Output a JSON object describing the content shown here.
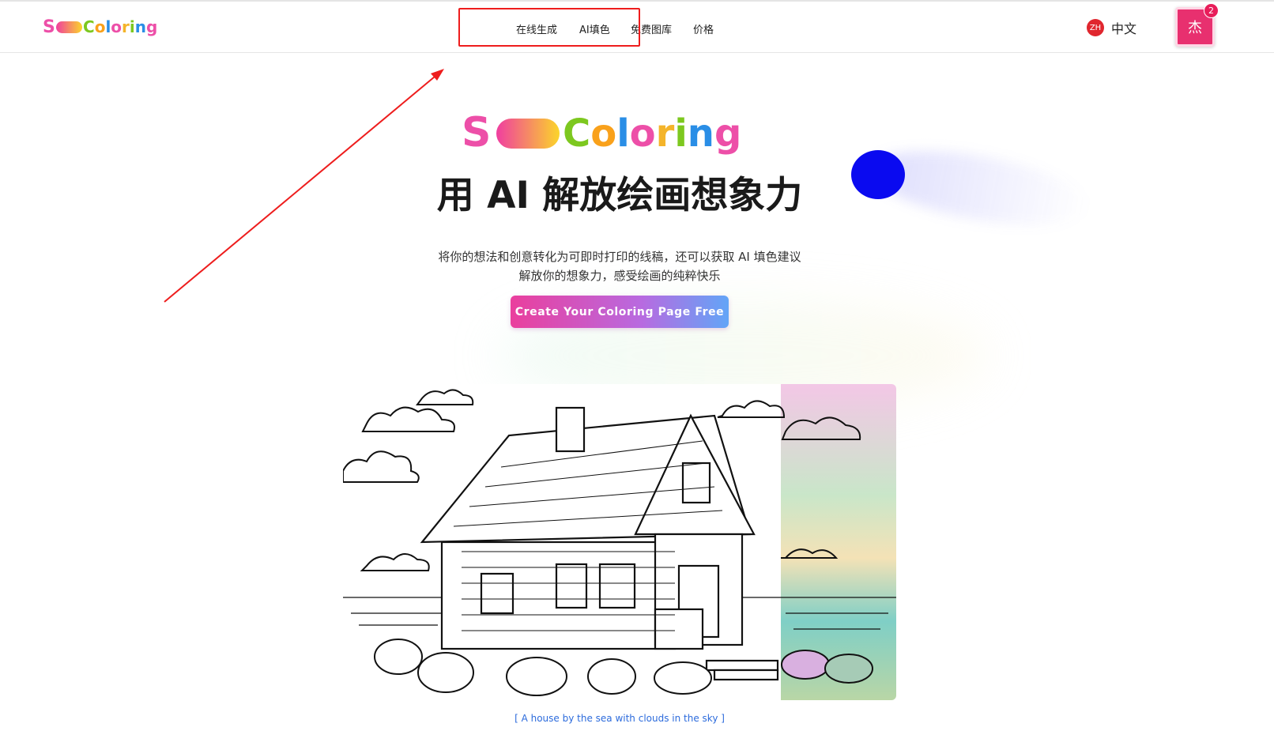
{
  "brand": {
    "logo_text": "Coloring",
    "logo_initial": "S"
  },
  "nav": {
    "items": [
      {
        "label": "在线生成"
      },
      {
        "label": "AI填色"
      },
      {
        "label": "免费图库"
      },
      {
        "label": "价格"
      }
    ]
  },
  "language": {
    "code": "ZH",
    "label": "中文"
  },
  "user": {
    "avatar_char": "杰",
    "notification_count": "2"
  },
  "hero": {
    "title": "用 AI 解放绘画想象力",
    "subtitle_line1": "将你的想法和创意转化为可即时打印的线稿，还可以获取 AI 填色建议",
    "subtitle_line2": "解放你的想象力，感受绘画的纯粹快乐",
    "cta_label": "Create Your Coloring Page Free",
    "image_caption": "[ A house by the sea with clouds in the sky ]"
  },
  "colors": {
    "accent_pink": "#e8306f",
    "cta_gradient_start": "#ea3f9d",
    "cta_gradient_end": "#62a5f7",
    "annotation_red": "#ee1d1d",
    "caption_blue": "#2c6bdc"
  },
  "icons": {
    "lang_badge": "zh-badge-icon",
    "avatar": "user-avatar-icon",
    "annotation": "red-arrow-icon"
  }
}
